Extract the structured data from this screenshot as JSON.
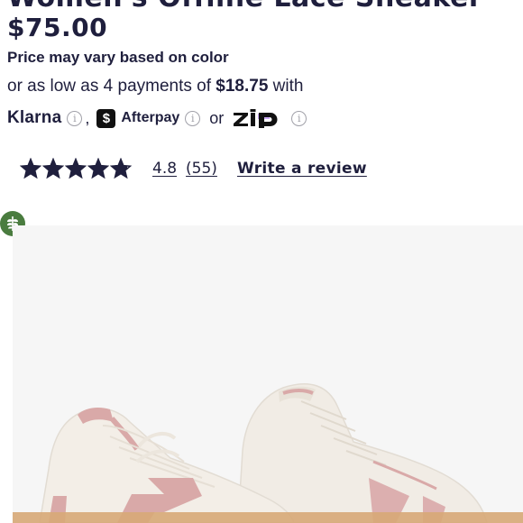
{
  "product": {
    "title": "Women's Offline Lace Sneaker",
    "price": "$75.00",
    "price_note": "Price may vary based on color"
  },
  "installments": {
    "prefix": "or as low as 4 payments of ",
    "amount": "$18.75",
    "suffix": " with"
  },
  "payment_options": {
    "klarna_label": "Klarna",
    "comma": ",",
    "afterpay_badge": "$",
    "afterpay_label": "Afterpay",
    "or_label": "or",
    "info_glyph": "i"
  },
  "rating": {
    "value": "4.8",
    "count": "(55)",
    "stars": 4.8,
    "max_stars": 5,
    "write_review_label": "Write a review"
  },
  "colors": {
    "text": "#1f1f3d",
    "star": "#1f1f3d",
    "eco_badge": "#4a7c3f",
    "shoe_body": "#f1ece5",
    "shoe_accent": "#d9a9a8",
    "sole": "#d7a977"
  },
  "icons": {
    "info": "info-circle-icon",
    "afterpay": "afterpay-logo-icon",
    "zip": "zip-logo-icon",
    "eco": "leaf-badge-icon"
  }
}
